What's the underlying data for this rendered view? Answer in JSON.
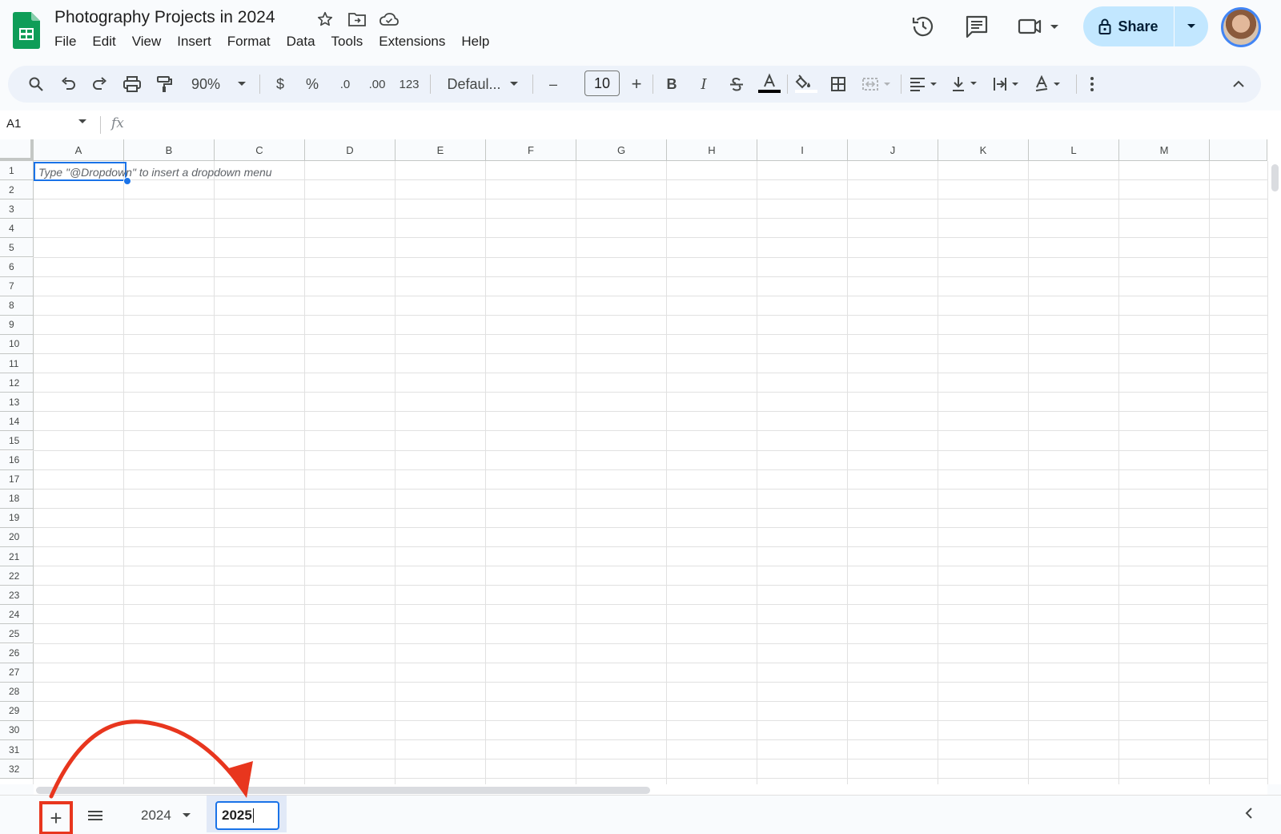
{
  "doc": {
    "title": "Photography Projects in 2024"
  },
  "menu": [
    "File",
    "Edit",
    "View",
    "Insert",
    "Format",
    "Data",
    "Tools",
    "Extensions",
    "Help"
  ],
  "share": {
    "label": "Share"
  },
  "toolbar": {
    "zoom": "90%",
    "currency": "$",
    "percent": "%",
    "dec_decrease": ".0",
    "dec_increase": ".00",
    "more_formats": "123",
    "font": "Defaul...",
    "font_size": "10",
    "minus": "–",
    "plus": "+",
    "bold": "B",
    "italic": "I"
  },
  "formula_bar": {
    "cell_ref": "A1",
    "fx": "fx"
  },
  "grid": {
    "columns": [
      "A",
      "B",
      "C",
      "D",
      "E",
      "F",
      "G",
      "H",
      "I",
      "J",
      "K",
      "L",
      "M"
    ],
    "row_count": 32,
    "hint": "Type \"@Dropdown\"  to insert a dropdown menu"
  },
  "sheets": {
    "add": "+",
    "tabs": [
      {
        "name": "2024"
      },
      {
        "name": "2025",
        "editing": true
      }
    ]
  },
  "colors": {
    "share_bg": "#c2e7ff",
    "accent": "#1a73e8",
    "annotation": "#e8361e",
    "toolbar_bg": "#edf2fa"
  }
}
